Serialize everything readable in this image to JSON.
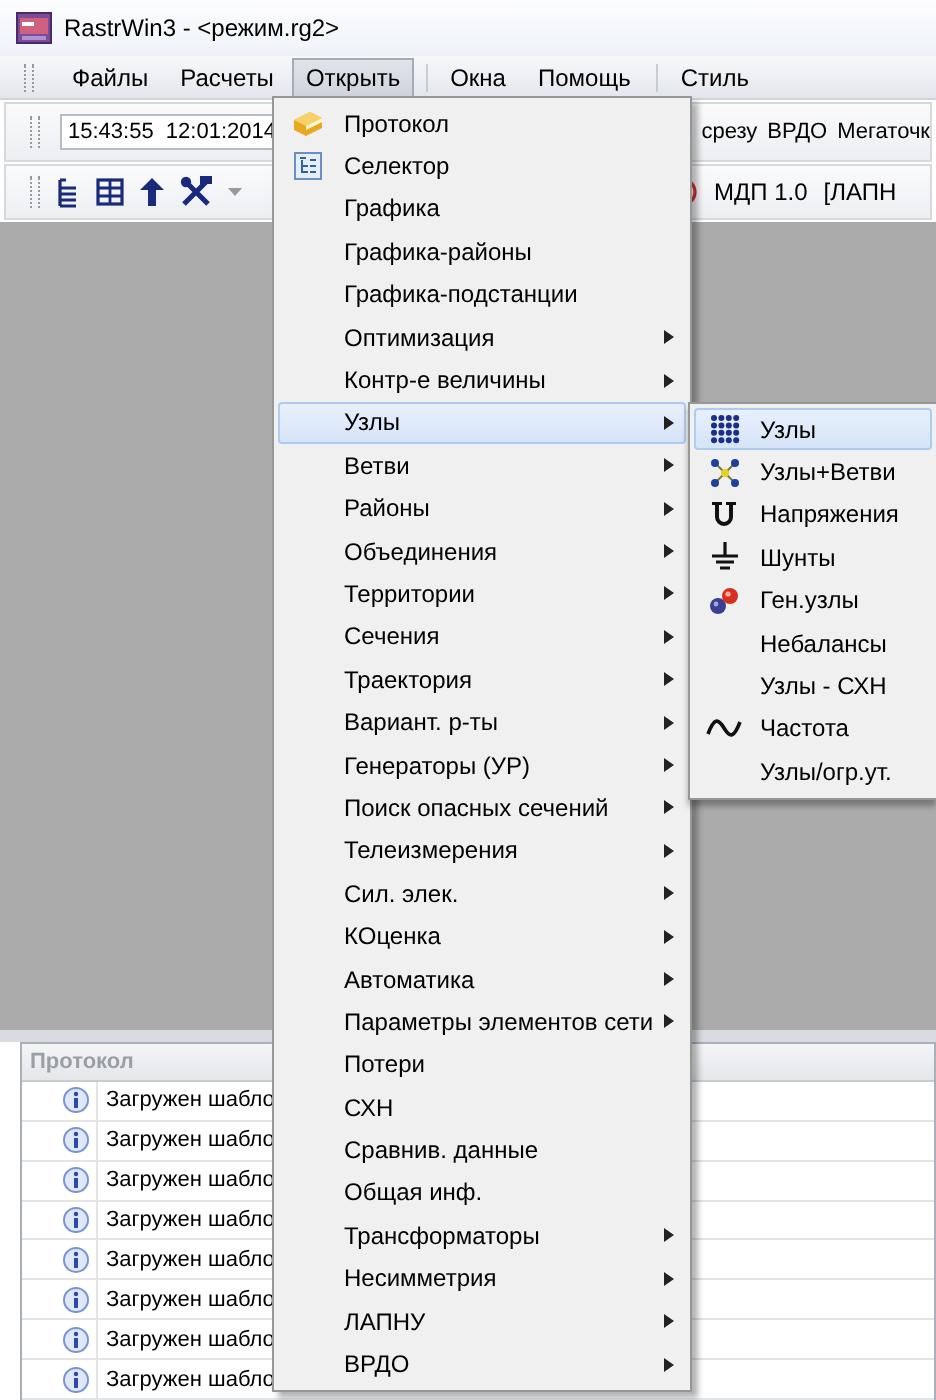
{
  "window": {
    "title": "RastrWin3 - <режим.rg2>"
  },
  "menu_bar": [
    {
      "label": "Файлы",
      "selected": false
    },
    {
      "label": "Расчеты",
      "selected": false
    },
    {
      "label": "Открыть",
      "selected": true
    },
    {
      "label": "Окна",
      "selected": false
    },
    {
      "label": "Помощь",
      "selected": false
    },
    {
      "label": "Стиль",
      "selected": false
    }
  ],
  "toolbar_1": {
    "time_field": "15:43:55  12:01:2014",
    "buttons": [
      "срезу",
      "ВРДО",
      "Мегаточк"
    ]
  },
  "toolbar_2": {
    "mdp_label": "МДП 1.0",
    "mode_label": "[ЛАПН"
  },
  "protocol_panel": {
    "title": "Протокол",
    "rows": [
      {
        "text": "Загружен шабло"
      },
      {
        "text": "Загружен шабло"
      },
      {
        "text": "Загружен шабло"
      },
      {
        "text": "Загружен шабло"
      },
      {
        "text": "Загружен шабло"
      },
      {
        "text": "Загружен шабло"
      },
      {
        "text": "Загружен шабло"
      },
      {
        "text": "Загружен шабло"
      }
    ]
  },
  "open_menu": {
    "items": [
      {
        "label": "Протокол",
        "kind": "book",
        "submenu": false,
        "selected": false
      },
      {
        "label": "Селектор",
        "kind": "tree",
        "submenu": false,
        "selected": false
      },
      {
        "label": "Графика",
        "kind": "plain",
        "submenu": false,
        "selected": false
      },
      {
        "label": "Графика-районы",
        "kind": "plain",
        "submenu": false,
        "selected": false
      },
      {
        "label": "Графика-подстанции",
        "kind": "plain",
        "submenu": false,
        "selected": false
      },
      {
        "label": "Оптимизация",
        "kind": "plain",
        "submenu": true,
        "selected": false
      },
      {
        "label": "Контр-е величины",
        "kind": "plain",
        "submenu": true,
        "selected": false
      },
      {
        "label": "Узлы",
        "kind": "plain",
        "submenu": true,
        "selected": true
      },
      {
        "label": "Ветви",
        "kind": "plain",
        "submenu": true,
        "selected": false
      },
      {
        "label": "Районы",
        "kind": "plain",
        "submenu": true,
        "selected": false
      },
      {
        "label": "Объединения",
        "kind": "plain",
        "submenu": true,
        "selected": false
      },
      {
        "label": "Территории",
        "kind": "plain",
        "submenu": true,
        "selected": false
      },
      {
        "label": "Сечения",
        "kind": "plain",
        "submenu": true,
        "selected": false
      },
      {
        "label": "Траектория",
        "kind": "plain",
        "submenu": true,
        "selected": false
      },
      {
        "label": "Вариант. р-ты",
        "kind": "plain",
        "submenu": true,
        "selected": false
      },
      {
        "label": "Генераторы (УР)",
        "kind": "plain",
        "submenu": true,
        "selected": false
      },
      {
        "label": "Поиск опасных сечений",
        "kind": "plain",
        "submenu": true,
        "selected": false
      },
      {
        "label": "Телеизмерения",
        "kind": "plain",
        "submenu": true,
        "selected": false
      },
      {
        "label": "Сил. элек.",
        "kind": "plain",
        "submenu": true,
        "selected": false
      },
      {
        "label": "КОценка",
        "kind": "plain",
        "submenu": true,
        "selected": false
      },
      {
        "label": "Автоматика",
        "kind": "plain",
        "submenu": true,
        "selected": false
      },
      {
        "label": "Параметры элементов сети",
        "kind": "plain",
        "submenu": true,
        "selected": false
      },
      {
        "label": "Потери",
        "kind": "plain",
        "submenu": false,
        "selected": false
      },
      {
        "label": "СХН",
        "kind": "plain",
        "submenu": false,
        "selected": false
      },
      {
        "label": "Сравнив. данные",
        "kind": "plain",
        "submenu": false,
        "selected": false
      },
      {
        "label": "Общая инф.",
        "kind": "plain",
        "submenu": false,
        "selected": false
      },
      {
        "label": "Трансформаторы",
        "kind": "plain",
        "submenu": true,
        "selected": false
      },
      {
        "label": "Несимметрия",
        "kind": "plain",
        "submenu": true,
        "selected": false
      },
      {
        "label": "ЛАПНУ",
        "kind": "plain",
        "submenu": true,
        "selected": false
      },
      {
        "label": "ВРДО",
        "kind": "plain",
        "submenu": true,
        "selected": false
      }
    ]
  },
  "submenu": {
    "items": [
      {
        "label": "Узлы",
        "kind": "grid",
        "selected": true
      },
      {
        "label": "Узлы+Ветви",
        "kind": "cross",
        "selected": false
      },
      {
        "label": "Напряжения",
        "kind": "ushape",
        "selected": false
      },
      {
        "label": "Шунты",
        "kind": "ground",
        "selected": false
      },
      {
        "label": "Ген.узлы",
        "kind": "balls",
        "selected": false
      },
      {
        "label": "Небалансы",
        "kind": "plain",
        "selected": false
      },
      {
        "label": "Узлы - СХН",
        "kind": "plain",
        "selected": false
      },
      {
        "label": "Частота",
        "kind": "wave",
        "selected": false
      },
      {
        "label": "Узлы/огр.ут.",
        "kind": "plain",
        "selected": false
      }
    ]
  }
}
